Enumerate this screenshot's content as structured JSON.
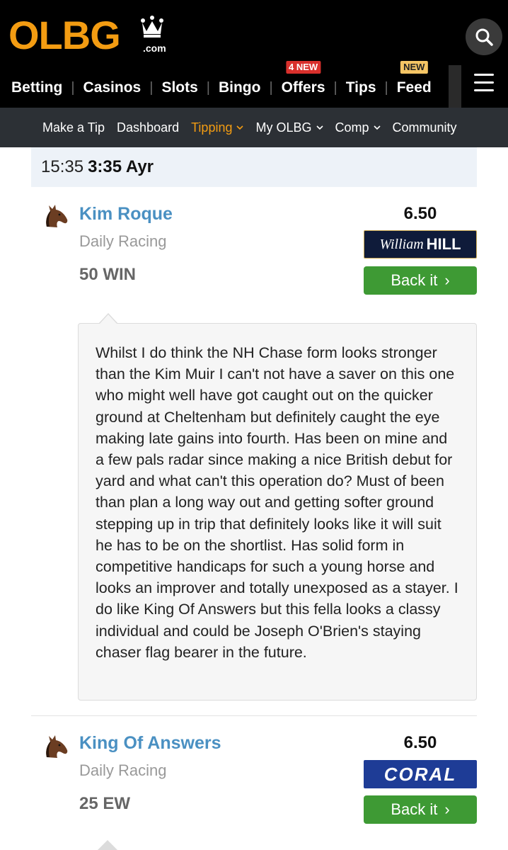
{
  "header": {
    "logo_text": "OLBG",
    "logo_suffix": ".com",
    "nav": [
      {
        "label": "Betting",
        "badge": ""
      },
      {
        "label": "Casinos",
        "badge": ""
      },
      {
        "label": "Slots",
        "badge": ""
      },
      {
        "label": "Bingo",
        "badge": ""
      },
      {
        "label": "Offers",
        "badge": "4 NEW"
      },
      {
        "label": "Tips",
        "badge": ""
      },
      {
        "label": "Feed",
        "badge": "NEW"
      }
    ],
    "icons": {
      "search": "search-icon",
      "menu": "hamburger-menu-icon",
      "crown": "crown-icon"
    },
    "colors": {
      "brand": "#f39c12",
      "badge_new_offers": "#d9302c",
      "badge_new_feed": "#f5c565"
    }
  },
  "subnav": [
    {
      "label": "Make a Tip",
      "has_dropdown": false
    },
    {
      "label": "Dashboard",
      "has_dropdown": false
    },
    {
      "label": "Tipping",
      "has_dropdown": true,
      "active": true
    },
    {
      "label": "My OLBG",
      "has_dropdown": true
    },
    {
      "label": "Comp",
      "has_dropdown": true
    },
    {
      "label": "Community",
      "has_dropdown": false
    }
  ],
  "race": {
    "time": "15:35",
    "course": "3:35 Ayr"
  },
  "tips": [
    {
      "horse": "Kim Roque",
      "competition": "Daily Racing",
      "stake": "50 WIN",
      "odds": "6.50",
      "bookmaker": {
        "script": "William",
        "bold": "HILL"
      },
      "back_label": "Back it",
      "comment": "Whilst I do think the NH Chase form looks stronger than the Kim Muir I can't not have a saver on this one who might well have got caught out on the quicker ground at Cheltenham but definitely caught the eye making late gains into fourth. Has been on mine and a few pals radar since making a nice British debut for yard and what can't this operation do? Must of been than plan a long way out and getting softer ground stepping up in trip that definitely looks like it will suit he has to be on the shortlist. Has solid form in competitive handicaps for such a young horse and looks an improver and totally unexposed as a stayer. I do like King Of Answers but this fella looks a classy individual and could be Joseph O'Brien's staying chaser flag bearer in the future."
    },
    {
      "horse": "King Of Answers",
      "competition": "Daily Racing",
      "stake": "25 EW",
      "odds": "6.50",
      "bookmaker": {
        "name": "CORAL"
      },
      "back_label": "Back it"
    }
  ]
}
